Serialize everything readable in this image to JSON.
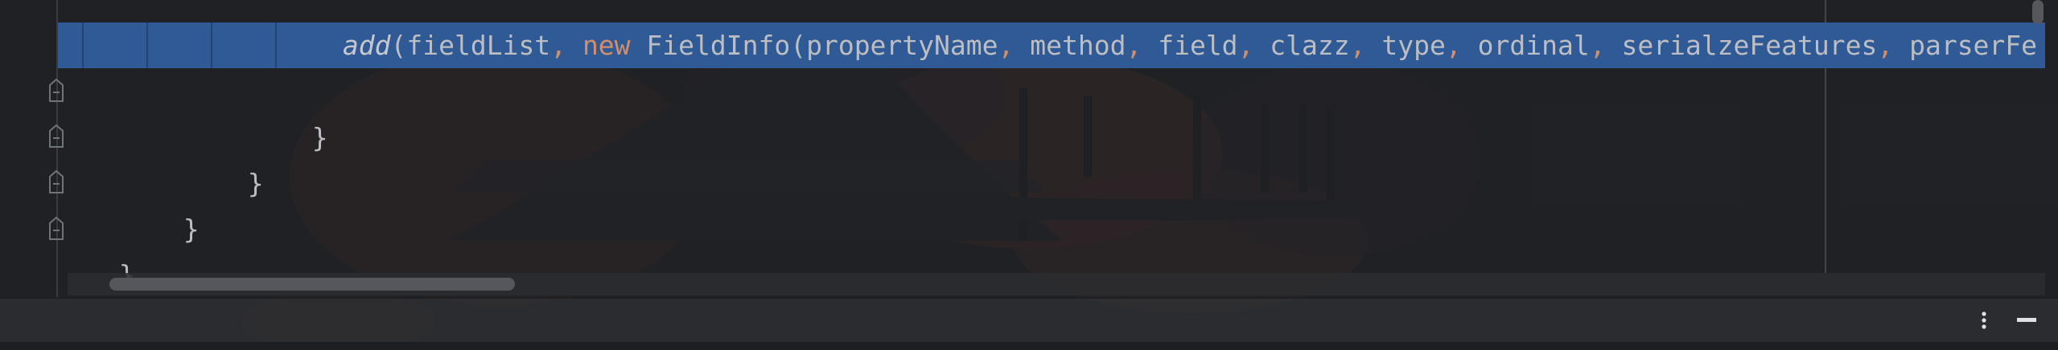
{
  "editor": {
    "lines": [
      {
        "indent": "                ",
        "tokens": [
          {
            "text": "add",
            "kind": "fn"
          },
          {
            "text": "(fieldList",
            "kind": "plain"
          },
          {
            "text": ",",
            "kind": "punc"
          },
          {
            "text": " ",
            "kind": "plain"
          },
          {
            "text": "new",
            "kind": "kw"
          },
          {
            "text": " FieldInfo(propertyName",
            "kind": "plain"
          },
          {
            "text": ",",
            "kind": "punc"
          },
          {
            "text": " method",
            "kind": "plain"
          },
          {
            "text": ",",
            "kind": "punc"
          },
          {
            "text": " field",
            "kind": "plain"
          },
          {
            "text": ",",
            "kind": "punc"
          },
          {
            "text": " clazz",
            "kind": "plain"
          },
          {
            "text": ",",
            "kind": "punc"
          },
          {
            "text": " type",
            "kind": "plain"
          },
          {
            "text": ",",
            "kind": "punc"
          },
          {
            "text": " ordinal",
            "kind": "plain"
          },
          {
            "text": ",",
            "kind": "punc"
          },
          {
            "text": " serialzeFeatures",
            "kind": "plain"
          },
          {
            "text": ",",
            "kind": "punc"
          },
          {
            "text": " parserFe",
            "kind": "plain"
          }
        ]
      },
      {
        "text": "}"
      },
      {
        "text": "}"
      },
      {
        "text": "}"
      },
      {
        "text": "}"
      }
    ],
    "selection_color": "#2f5a95",
    "keyword_color": "#cf8e6d",
    "text_color": "#bcbec4"
  },
  "icons": {
    "fold": "fold-collapse-icon",
    "more": "more-vertical-icon",
    "hide": "minimize-icon"
  }
}
